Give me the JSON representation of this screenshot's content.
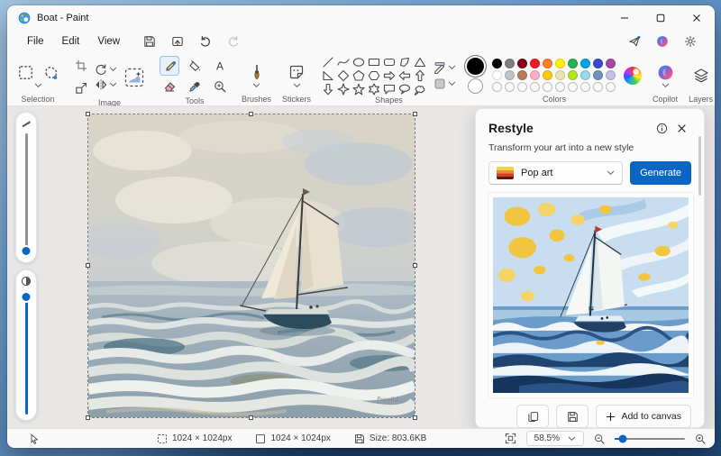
{
  "window": {
    "title": "Boat - Paint"
  },
  "menu": {
    "items": [
      "File",
      "Edit",
      "View"
    ]
  },
  "ribbon": {
    "sections": [
      {
        "label": "Selection"
      },
      {
        "label": "Image"
      },
      {
        "label": "Tools"
      },
      {
        "label": "Brushes"
      },
      {
        "label": "Stickers"
      },
      {
        "label": "Shapes"
      },
      {
        "label": "Colors"
      },
      {
        "label": "Copilot"
      },
      {
        "label": "Layers"
      }
    ],
    "selection_tools": [
      "rectangle-select",
      "free-form-select"
    ],
    "image_tools": [
      "crop",
      "resize",
      "rotate",
      "flip",
      "remove-background"
    ],
    "tools": [
      "pencil",
      "fill",
      "text",
      "eraser",
      "eyedropper",
      "magnifier"
    ],
    "selected_tool": "pencil",
    "shapes": [
      "line",
      "curve",
      "oval",
      "rectangle",
      "rounded-rectangle",
      "polygon",
      "triangle",
      "right-triangle",
      "diamond",
      "pentagon",
      "hexagon",
      "arrow-right",
      "arrow-left",
      "arrow-up",
      "arrow-down",
      "star-four",
      "star-five",
      "star-six",
      "speech-rectangle",
      "speech-oval",
      "thought-cloud"
    ],
    "shape_options": [
      "shape-outline",
      "shape-fill"
    ]
  },
  "colors": {
    "foreground": "#000000",
    "background": "#ffffff",
    "palette_row1": [
      "#000000",
      "#7f7f7f",
      "#880015",
      "#ed1c24",
      "#ff7f27",
      "#fff200",
      "#22b14c",
      "#00a2e8",
      "#3f48cc",
      "#a349a4"
    ],
    "palette_row2": [
      "#ffffff",
      "#c3c3c3",
      "#b97a57",
      "#ffaec9",
      "#ffc90e",
      "#efe4b0",
      "#b5e61d",
      "#99d9ea",
      "#7092be",
      "#c8bfe7"
    ],
    "empty_slots": 10
  },
  "restyle": {
    "title": "Restyle",
    "subtitle": "Transform your art into a new style",
    "style_value": "Pop art",
    "generate_label": "Generate",
    "add_to_canvas_label": "Add to canvas"
  },
  "status": {
    "selection_size": "1024 × 1024px",
    "canvas_size": "1024 × 1024px",
    "file_size": "Size: 803.6KB",
    "zoom_level": "58.5%"
  },
  "theme": {
    "accent": "#0b66c3"
  }
}
